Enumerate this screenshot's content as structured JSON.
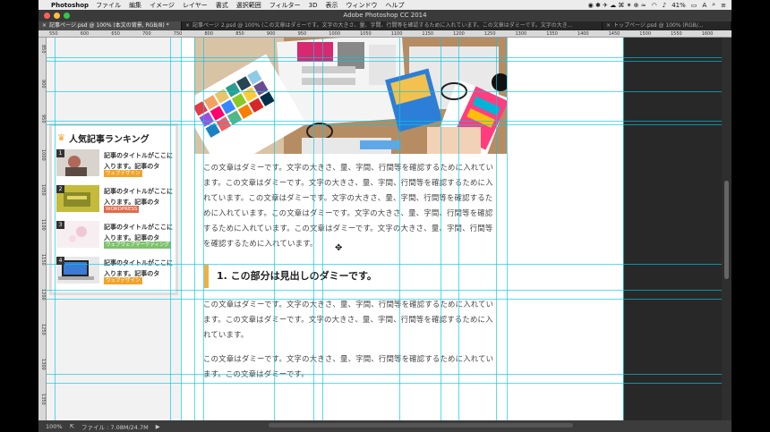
{
  "menubar": {
    "app": "Photoshop",
    "items": [
      "ファイル",
      "編集",
      "イメージ",
      "レイヤー",
      "書式",
      "選択範囲",
      "フィルター",
      "3D",
      "表示",
      "ウィンドウ",
      "ヘルプ"
    ],
    "battery": "41%",
    "clock": "≡"
  },
  "window": {
    "title": "Adobe Photoshop CC 2014"
  },
  "tabs": [
    {
      "label": "記事ページ.psd @ 100% (本文の背景, RGB/8) *"
    },
    {
      "label": "記事ページ 2.psd @ 100% (この文章はダミーです。文字の大きさ、量、字間、行間等を確認するために入れています。この文章はダミーです。文字の大き..."
    },
    {
      "label": "トップページ.psd @ 100% (RGB/..."
    }
  ],
  "ruler_top": [
    "550",
    "600",
    "650",
    "700",
    "750",
    "800",
    "850",
    "900",
    "950",
    "1000",
    "1050",
    "1100",
    "1150",
    "1200",
    "1250",
    "1300",
    "1350",
    "1400",
    "1450",
    "1500",
    "1550",
    "1600"
  ],
  "ruler_left": [
    "850",
    "900",
    "950",
    "1000",
    "1050",
    "1100",
    "1150",
    "1200",
    "1250",
    "1300",
    "1350"
  ],
  "sidebar": {
    "title": "人気記事ランキング",
    "items": [
      {
        "num": "1",
        "text": "記事のタイトルがここに入ります。記事のタ",
        "tag": "ウェブデザイン",
        "tag_color": "#f3a32a"
      },
      {
        "num": "2",
        "text": "記事のタイトルがここに入ります。記事のタ",
        "tag": "WORDPRESS",
        "tag_color": "#e26a4a"
      },
      {
        "num": "3",
        "text": "記事のタイトルがここに入ります。記事のタ",
        "tag": "ウェブウェブマーケティング",
        "tag_color": "#7cc36a"
      },
      {
        "num": "4",
        "text": "記事のタイトルがここに入ります。記事のタ",
        "tag": "ウェブデザイン",
        "tag_color": "#f3a32a"
      }
    ]
  },
  "article": {
    "para1": "この文章はダミーです。文字の大きさ、量、字間、行間等を確認するために入れています。この文章はダミーです。文字の大きさ、量、字間、行間等を確認するために入れています。この文章はダミーです。文字の大きさ、量、字間、行間等を確認するために入れています。この文章はダミーです。文字の大きさ、量、字間、行間等を確認するために入れています。この文章はダミーです。文字の大きさ、量、字間、行間等を確認するために入れています。",
    "heading": "1. この部分は見出しのダミーです。",
    "para2": "この文章はダミーです。文字の大きさ、量、字間、行間等を確認するために入れています。この文章はダミーです。文字の大きさ、量、字間、行間等を確認するために入れています。",
    "para3": "この文章はダミーです。文字の大きさ、量、字間、行間等を確認するために入れています。この文章はダミーです。"
  },
  "status": {
    "zoom": "100%",
    "file": "ファイル : 7.08M/24.7M"
  },
  "colors": {
    "guide": "#00c8e6",
    "heading_bar": "#f0b040",
    "crown": "#f3a32a"
  }
}
